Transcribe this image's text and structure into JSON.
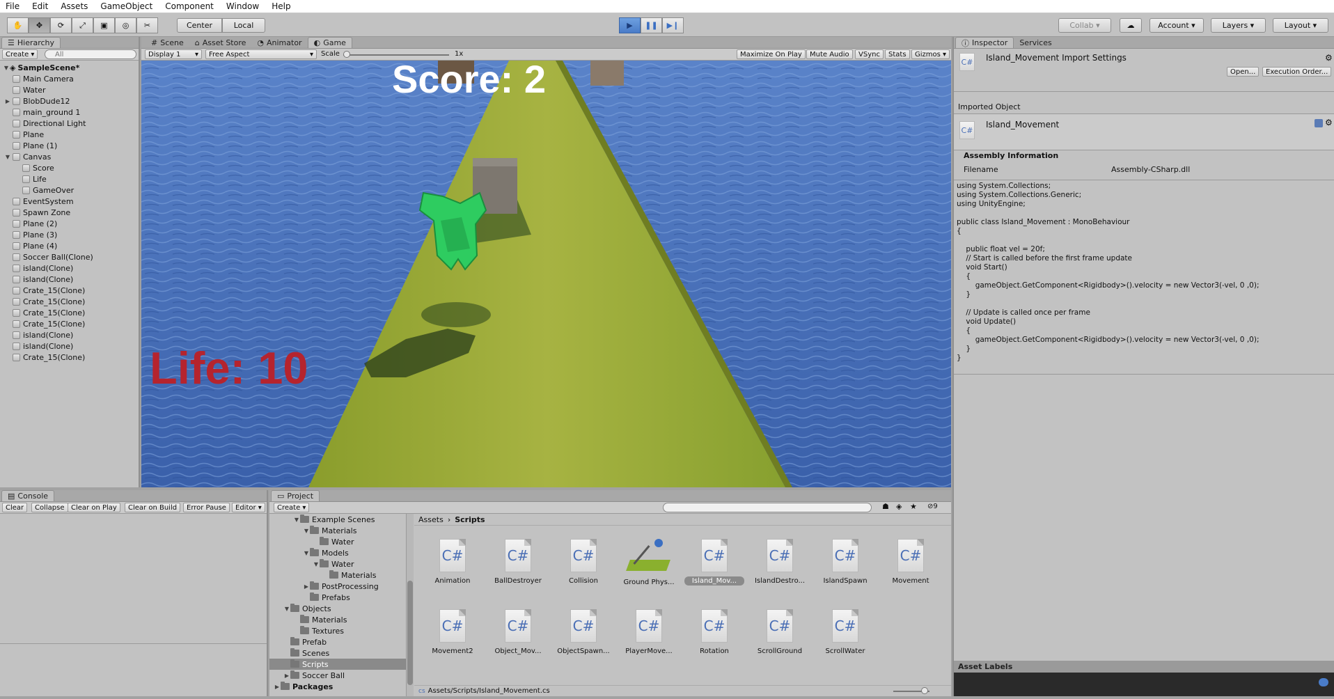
{
  "menu": [
    "File",
    "Edit",
    "Assets",
    "GameObject",
    "Component",
    "Window",
    "Help"
  ],
  "toolbar": {
    "center": "Center",
    "local": "Local",
    "collab": "Collab",
    "account": "Account",
    "layers": "Layers",
    "layout": "Layout"
  },
  "hierarchy": {
    "tab": "Hierarchy",
    "create": "Create",
    "search_placeholder": "All",
    "scene": "SampleScene*",
    "items": [
      "Main Camera",
      "Water",
      "BlobDude12",
      "main_ground 1",
      "Directional Light",
      "Plane",
      "Plane (1)",
      "Canvas",
      "Score",
      "Life",
      "GameOver",
      "EventSystem",
      "Spawn Zone",
      "Plane (2)",
      "Plane (3)",
      "Plane (4)",
      "Soccer Ball(Clone)",
      "island(Clone)",
      "island(Clone)",
      "Crate_15(Clone)",
      "Crate_15(Clone)",
      "Crate_15(Clone)",
      "Crate_15(Clone)",
      "island(Clone)",
      "island(Clone)",
      "Crate_15(Clone)"
    ]
  },
  "view_tabs": [
    "Scene",
    "Asset Store",
    "Animator",
    "Game"
  ],
  "game_bar": {
    "display": "Display 1",
    "aspect": "Free Aspect",
    "scale_label": "Scale",
    "scale_value": "1x",
    "maximize": "Maximize On Play",
    "mute": "Mute Audio",
    "vsync": "VSync",
    "stats": "Stats",
    "gizmos": "Gizmos"
  },
  "game": {
    "score": "Score: 2",
    "life": "Life: 10"
  },
  "inspector": {
    "tabs": [
      "Inspector",
      "Services"
    ],
    "title": "Island_Movement Import Settings",
    "open": "Open...",
    "exec": "Execution Order...",
    "imported_object": "Imported Object",
    "object_name": "Island_Movement",
    "assembly_header": "Assembly Information",
    "filename_label": "Filename",
    "filename_value": "Assembly-CSharp.dll",
    "code": "using System.Collections;\nusing System.Collections.Generic;\nusing UnityEngine;\n\npublic class Island_Movement : MonoBehaviour\n{\n\n    public float vel = 20f;\n    // Start is called before the first frame update\n    void Start()\n    {\n        gameObject.GetComponent<Rigidbody>().velocity = new Vector3(-vel, 0 ,0);\n    }\n\n    // Update is called once per frame\n    void Update()\n    {\n        gameObject.GetComponent<Rigidbody>().velocity = new Vector3(-vel, 0 ,0);\n    }\n}",
    "asset_labels": "Asset Labels"
  },
  "console": {
    "tab": "Console",
    "buttons": [
      "Clear",
      "Collapse",
      "Clear on Play",
      "Clear on Build",
      "Error Pause",
      "Editor"
    ]
  },
  "project": {
    "tab": "Project",
    "create": "Create",
    "badge": "9",
    "breadcrumb": [
      "Assets",
      "Scripts"
    ],
    "tree": [
      {
        "label": "Example Scenes",
        "indent": 2,
        "tri": "▼"
      },
      {
        "label": "Materials",
        "indent": 3,
        "tri": "▼"
      },
      {
        "label": "Water",
        "indent": 4,
        "tri": ""
      },
      {
        "label": "Models",
        "indent": 3,
        "tri": "▼"
      },
      {
        "label": "Water",
        "indent": 4,
        "tri": "▼"
      },
      {
        "label": "Materials",
        "indent": 5,
        "tri": ""
      },
      {
        "label": "PostProcessing",
        "indent": 3,
        "tri": "▶"
      },
      {
        "label": "Prefabs",
        "indent": 3,
        "tri": ""
      },
      {
        "label": "Objects",
        "indent": 1,
        "tri": "▼"
      },
      {
        "label": "Materials",
        "indent": 2,
        "tri": ""
      },
      {
        "label": "Textures",
        "indent": 2,
        "tri": ""
      },
      {
        "label": "Prefab",
        "indent": 1,
        "tri": ""
      },
      {
        "label": "Scenes",
        "indent": 1,
        "tri": ""
      },
      {
        "label": "Scripts",
        "indent": 1,
        "tri": ""
      },
      {
        "label": "Soccer Ball",
        "indent": 1,
        "tri": "▶"
      },
      {
        "label": "Packages",
        "indent": 0,
        "tri": "▶"
      }
    ],
    "assets": [
      "Animation",
      "BallDestroyer",
      "Collision",
      "Ground Phys...",
      "Island_Mov...",
      "IslandDestro...",
      "IslandSpawn",
      "Movement",
      "Movement2",
      "Object_Mov...",
      "ObjectSpawn...",
      "PlayerMove...",
      "Rotation",
      "ScrollGround",
      "ScrollWater"
    ],
    "cs_glyph": "C#",
    "path": "Assets/Scripts/Island_Movement.cs"
  },
  "colors": {
    "accent": "#4a7cc8",
    "score_text": "#ffffff",
    "life_text": "#b5242e",
    "water": "#4669b0",
    "ground": "#9aaa35",
    "player": "#2ecc60"
  }
}
